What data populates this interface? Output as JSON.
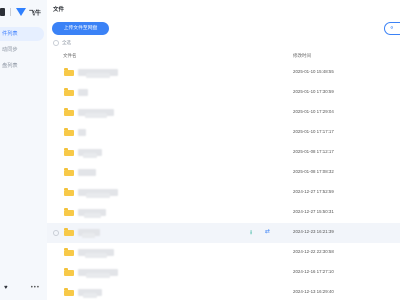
{
  "sidebar": {
    "nav": [
      {
        "label": "件列表",
        "active": true
      },
      {
        "label": "动同步",
        "active": false
      },
      {
        "label": "盘列表",
        "active": false
      }
    ],
    "logo_text": "飞牛"
  },
  "main": {
    "title": "文件",
    "upload_label": "上传文件至网盘",
    "share_icon": "share-icon",
    "select_all_label": "全选",
    "columns": {
      "name": "文件名",
      "modified": "修改时间"
    },
    "rows": [
      {
        "time": "2025-01-10 15:48:55",
        "w": 40
      },
      {
        "time": "2025-01-10 17:30:59",
        "w": 10
      },
      {
        "time": "2025-01-10 17:29:04",
        "w": 36
      },
      {
        "time": "2025-01-10 17:17:17",
        "w": 8
      },
      {
        "time": "2025-01-08 17:12:17",
        "w": 24
      },
      {
        "time": "2025-01-08 17:08:32",
        "w": 18
      },
      {
        "time": "2024-12-27 17:52:59",
        "w": 40
      },
      {
        "time": "2024-12-27 15:50:31",
        "w": 28
      },
      {
        "time": "2024-12-23 16:21:39",
        "w": 22
      },
      {
        "time": "2024-12-22 22:30:58",
        "w": 36
      },
      {
        "time": "2024-12-16 17:27:10",
        "w": 40
      },
      {
        "time": "2024-12-13 16:29:40",
        "w": 24
      }
    ]
  },
  "colors": {
    "accent": "#3b82f6",
    "folder": "#f7c948",
    "sidebar_bg": "#f5f8fc"
  }
}
